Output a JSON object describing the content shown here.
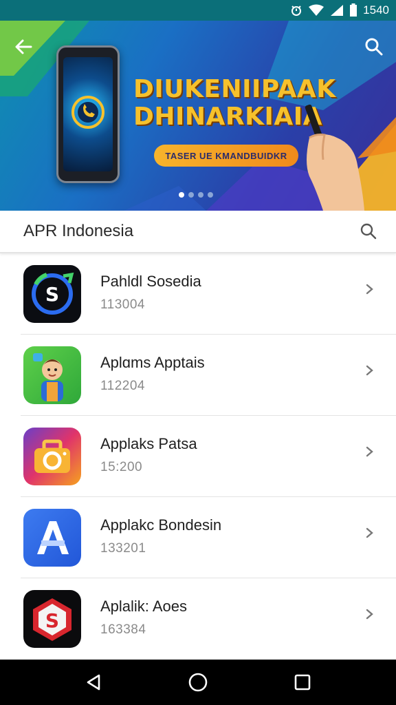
{
  "status_bar": {
    "time": "1540",
    "icons": [
      "alarm-icon",
      "wifi-icon",
      "signal-icon",
      "battery-icon"
    ]
  },
  "banner": {
    "headline_line1": "DIUKENIIPAAK",
    "headline_line2": "DHINARKIAIA",
    "tagline": "TASER UE KMANDBUIDKR",
    "pager_count": 4,
    "pager_active_index": 0,
    "colors": {
      "background": "#1a6fc4",
      "headline": "#f6c12c",
      "tagline_bg": "#f7b42c"
    }
  },
  "search_header": {
    "title": "APR Indonesia"
  },
  "apps": [
    {
      "name": "Pahldl Sosedia",
      "meta": "113004",
      "icon": "app-s-logo-icon"
    },
    {
      "name": "Aplɑms Apptais",
      "meta": "112204",
      "icon": "app-character-icon"
    },
    {
      "name": "Applaks Patsa",
      "meta": "15:200",
      "icon": "app-camera-icon"
    },
    {
      "name": "Applakc Bondesin",
      "meta": "133201",
      "icon": "app-letter-a-icon"
    },
    {
      "name": "Aplalik: Aoes",
      "meta": "163384",
      "icon": "app-s-badge-icon"
    }
  ],
  "nav_bar": {
    "buttons": [
      "back-icon",
      "home-icon",
      "recents-icon"
    ]
  }
}
